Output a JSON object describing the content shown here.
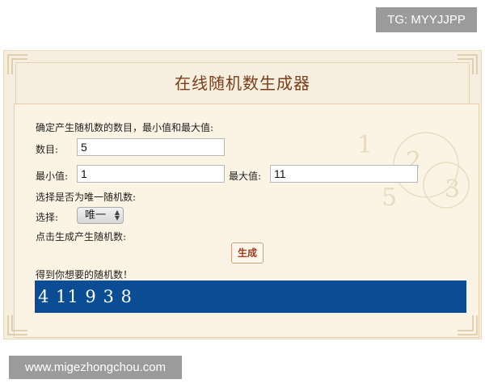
{
  "watermark_top": "TG: MYYJJPP",
  "watermark_bottom": "www.migezhongchou.com",
  "page_title": "在线随机数生成器",
  "instruction": "确定产生随机数的数目，最小值和最大值:",
  "count": {
    "label": "数目:",
    "value": "5"
  },
  "min": {
    "label": "最小值:",
    "value": "1"
  },
  "max": {
    "label": "最大值:",
    "value": "11"
  },
  "unique_prompt": "选择是否为唯一随机数:",
  "select": {
    "label": "选择:",
    "value": "唯一"
  },
  "generate_prompt": "点击生成产生随机数:",
  "generate_button": "生成",
  "result_label": "得到你想要的随机数！",
  "result_value": "4 11 9 3 8",
  "colors": {
    "result_bg": "#0b4d94",
    "title": "#7a3e1a",
    "button_text": "#a23a1a"
  }
}
